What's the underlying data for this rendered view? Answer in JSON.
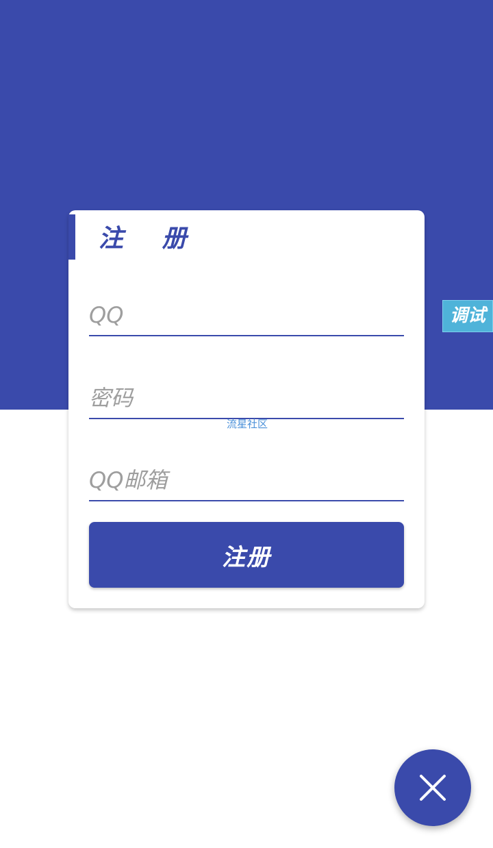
{
  "register_card": {
    "title": "注 册",
    "qq_field": {
      "placeholder": "QQ",
      "value": ""
    },
    "password_field": {
      "placeholder": "密码",
      "value": ""
    },
    "email_field": {
      "placeholder": "QQ邮箱",
      "value": ""
    },
    "submit_label": "注册"
  },
  "watermark_text": "流星社区",
  "debug_tab_label": "调试",
  "fab": {
    "icon": "close-icon"
  },
  "colors": {
    "primary": "#3a4aab",
    "debug_tab": "#4fb3d9",
    "watermark": "#4a90d9",
    "placeholder": "#9e9e9e",
    "background": "#ffffff"
  }
}
